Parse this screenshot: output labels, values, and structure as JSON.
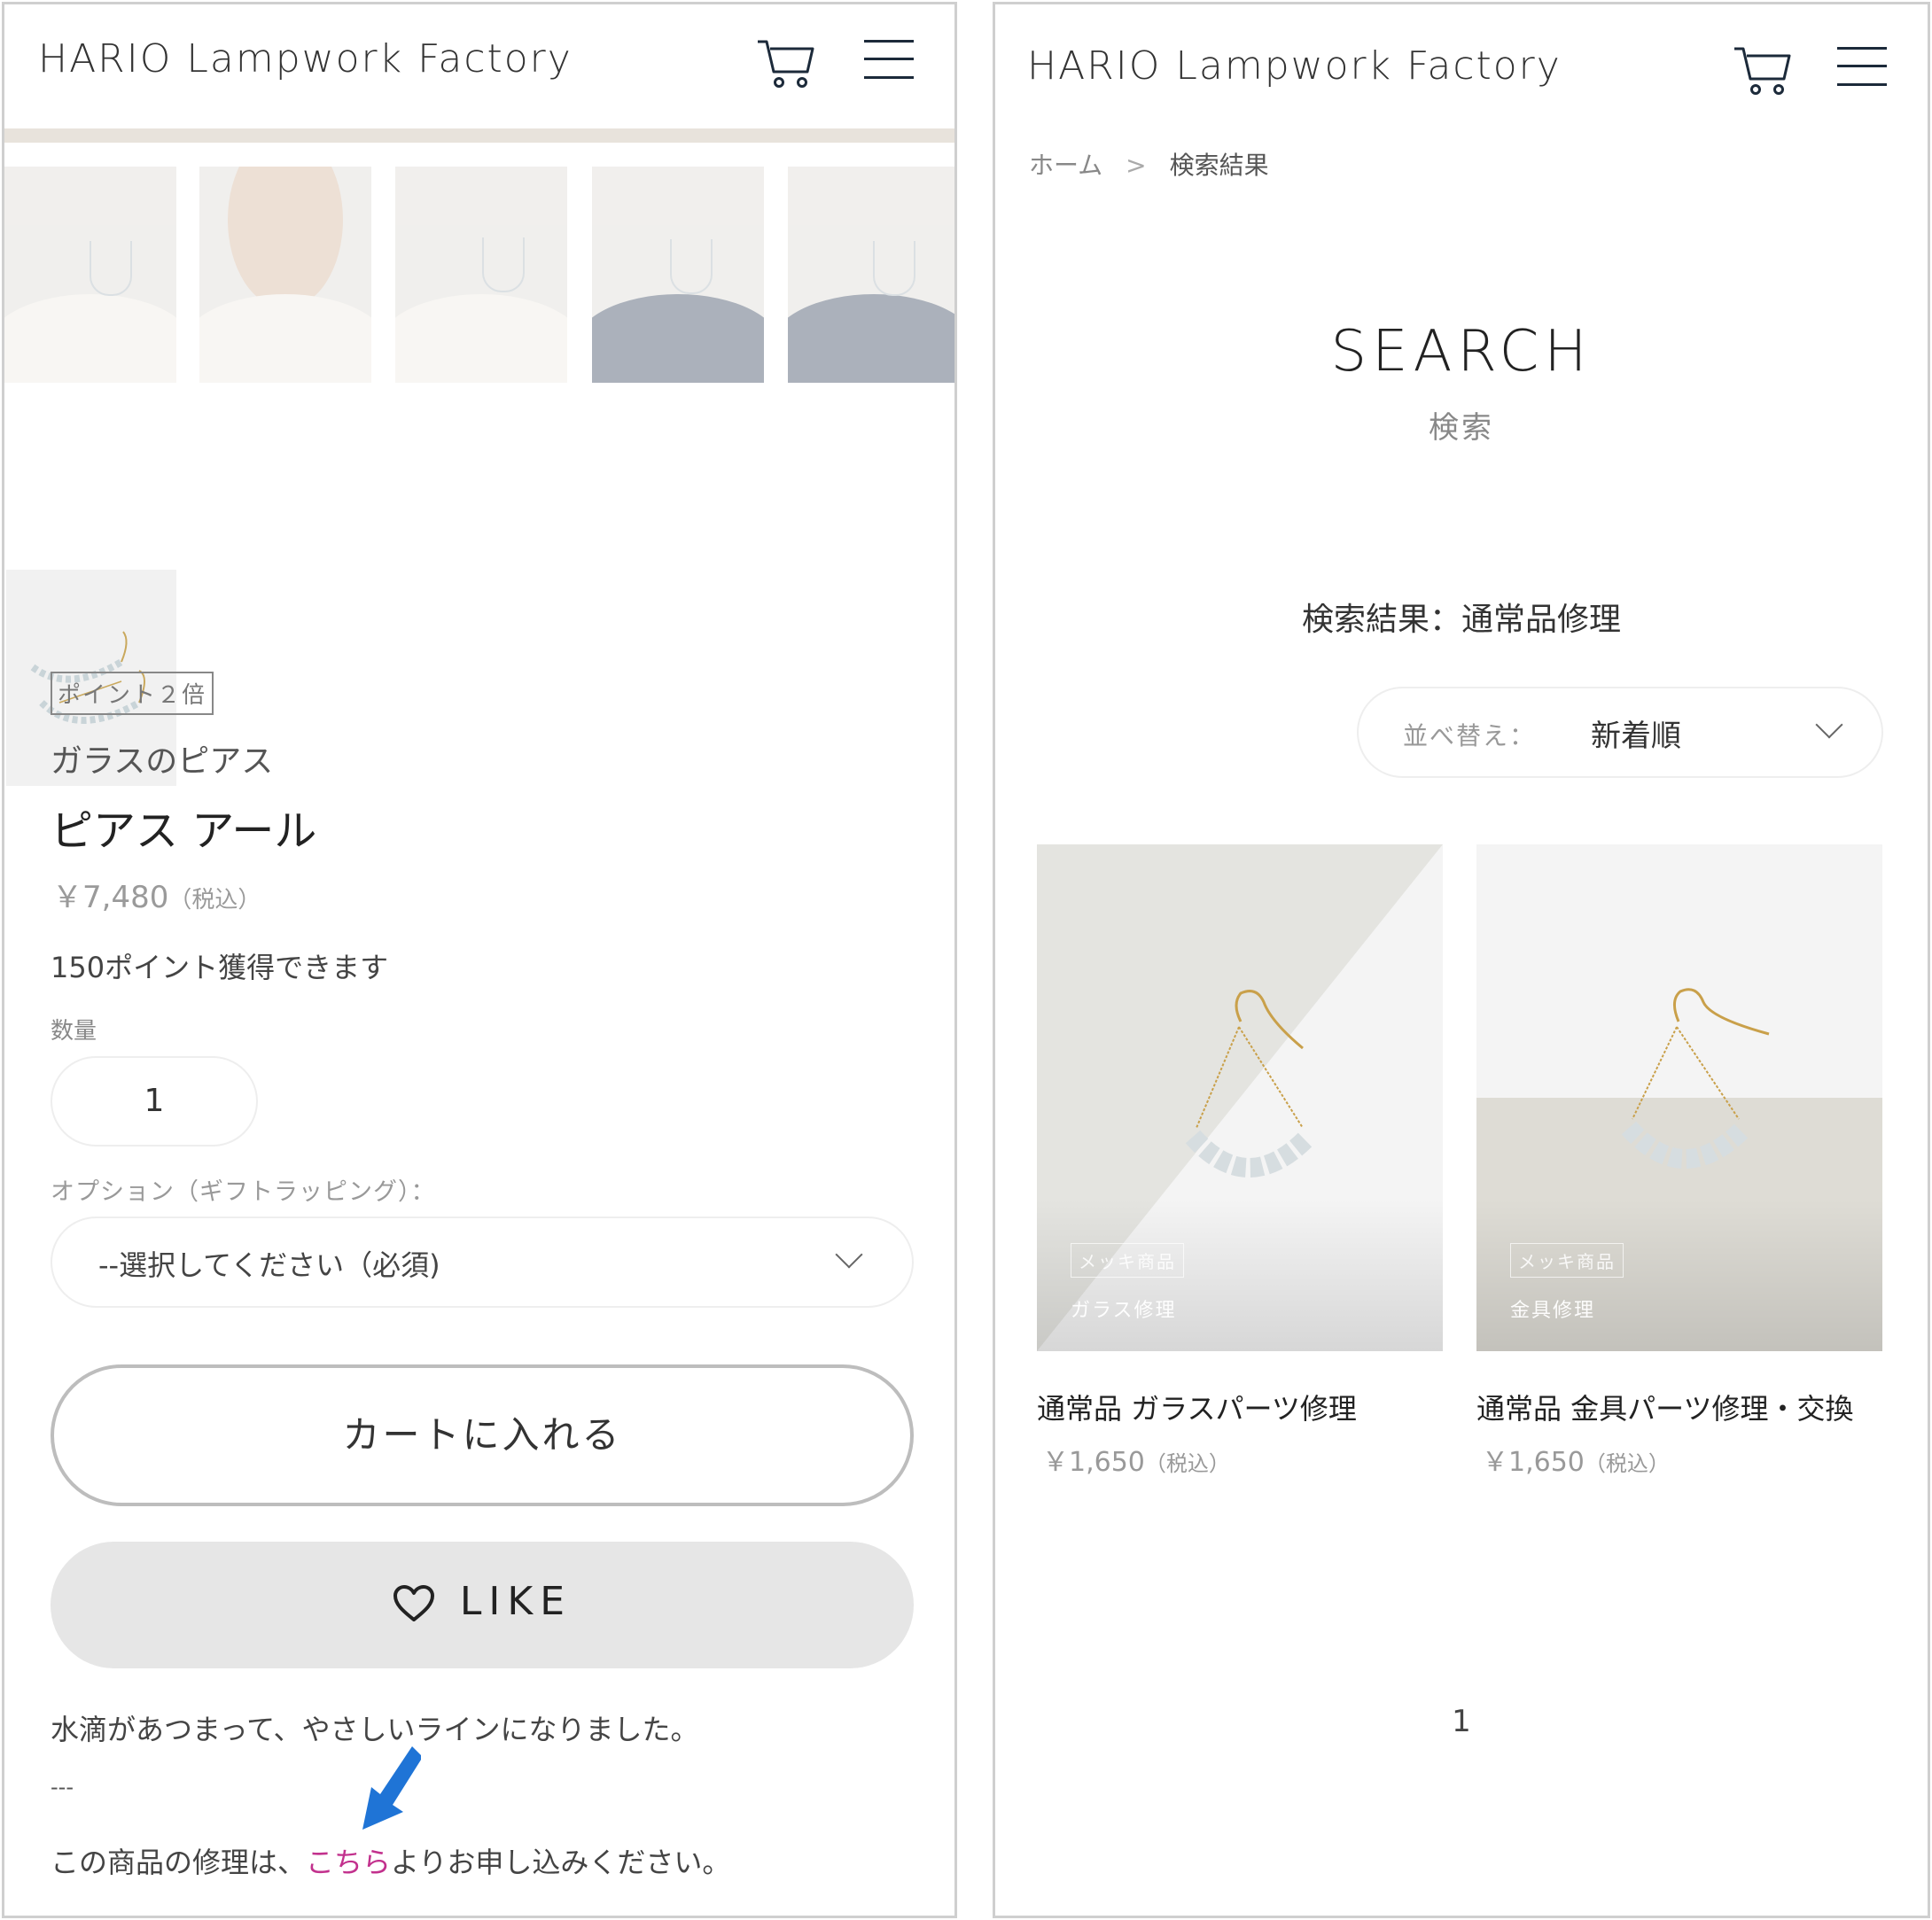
{
  "left": {
    "header": {
      "logo": "HARIO Lampwork Factory"
    },
    "product": {
      "badge": "ポイント２倍",
      "category": "ガラスのピアス",
      "name": "ピアス アール",
      "price": "￥7,480",
      "tax_note": "（税込）",
      "points_text": "150ポイント獲得できます",
      "quantity_label": "数量",
      "quantity_value": "1",
      "option_label": "オプション（ギフトラッピング）：",
      "option_placeholder": "--選択してください（必須)",
      "add_to_cart_label": "カートに入れる",
      "like_label": "LIKE",
      "description": "水滴があつまって、やさしいラインになりました。",
      "divider_text": "---",
      "repair_prefix": "この商品の修理は、",
      "repair_link": "こちら",
      "repair_suffix": "よりお申し込みください。"
    },
    "arrow_color": "#1f74d6"
  },
  "right": {
    "header": {
      "logo": "HARIO Lampwork Factory"
    },
    "breadcrumb": {
      "home": "ホーム",
      "separator": ">",
      "current": "検索結果"
    },
    "title": "SEARCH",
    "subtitle": "検索",
    "result_text": "検索結果：通常品修理",
    "sort": {
      "label": "並べ替え：",
      "value": "新着順"
    },
    "products": [
      {
        "tag": "メッキ商品",
        "overlay": "ガラス修理",
        "name": "通常品 ガラスパーツ修理",
        "price": "￥1,650",
        "tax_note": "（税込）"
      },
      {
        "tag": "メッキ商品",
        "overlay": "金具修理",
        "name": "通常品 金具パーツ修理・交換",
        "price": "￥1,650",
        "tax_note": "（税込）"
      }
    ],
    "pagination": {
      "current": "1"
    }
  },
  "colors": {
    "link": "#c2318d",
    "header_icon": "#1c2a3a",
    "like_bg": "#e6e6e6"
  },
  "icons": [
    "cart-icon",
    "menu-icon",
    "heart-icon",
    "chevron-down-icon",
    "arrow-pointer-icon"
  ]
}
